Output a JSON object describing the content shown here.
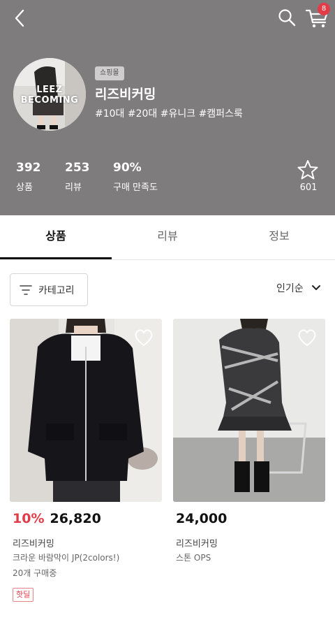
{
  "header": {
    "cart_badge": "8",
    "shop_tag": "쇼핑몰",
    "shop_name": "리즈비커밍",
    "hashtags": "#10대 #20대 #유니크 #캠퍼스룩",
    "avatar_text": [
      "LEEZ",
      "BECOMING"
    ],
    "stats": [
      {
        "value": "392",
        "label": "상품"
      },
      {
        "value": "253",
        "label": "리뷰"
      },
      {
        "value": "90%",
        "label": "구매 만족도"
      }
    ],
    "favorite_count": "601"
  },
  "tabs": [
    {
      "label": "상품",
      "active": true
    },
    {
      "label": "리뷰",
      "active": false
    },
    {
      "label": "정보",
      "active": false
    }
  ],
  "filter": {
    "category_label": "카테고리",
    "sort_label": "인기순"
  },
  "products": [
    {
      "discount": "10%",
      "price": "26,820",
      "brand": "리즈비커밍",
      "name": "크라운  바람막이 JP(2colors!)",
      "buyers": "20개 구매중",
      "badge": "핫딜"
    },
    {
      "discount": "",
      "price": "24,000",
      "brand": "리즈비커밍",
      "name": "스톤 OPS",
      "buyers": "",
      "badge": ""
    }
  ],
  "colors": {
    "header_bg": "#7e7c7d",
    "accent_red": "#e23c48"
  }
}
